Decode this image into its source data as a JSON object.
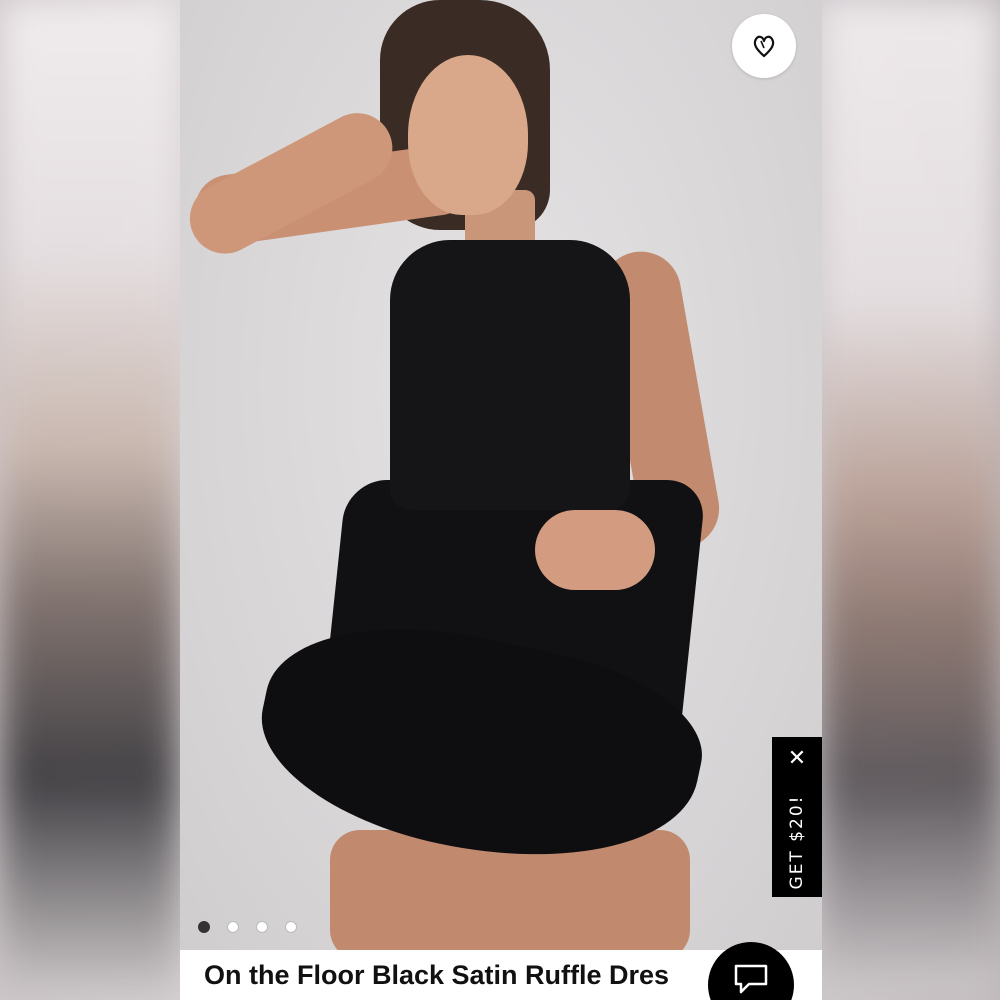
{
  "product": {
    "title": "On the Floor Black Satin Ruffle Dres",
    "image_alt": "model-wearing-black-satin-ruffle-dress"
  },
  "promo": {
    "label": "GET $20!",
    "close_glyph": "✕"
  },
  "carousel": {
    "count": 4,
    "active_index": 0
  },
  "icons": {
    "favorite": "heart-icon",
    "chat": "chat-bubble-icon"
  },
  "colors": {
    "promo_bg": "#000000",
    "title_text": "#111111"
  }
}
